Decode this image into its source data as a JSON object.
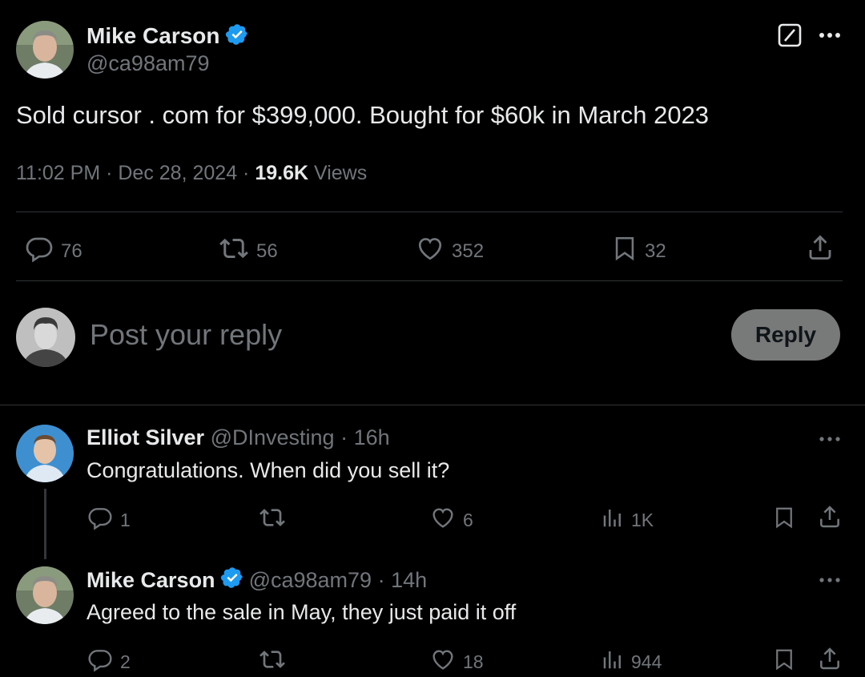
{
  "tweet": {
    "author_name": "Mike Carson",
    "author_handle": "@ca98am79",
    "text": "Sold cursor . com for $399,000. Bought for $60k in March 2023",
    "time": "11:02 PM",
    "date": "Dec 28, 2024",
    "views_count": "19.6K",
    "views_label": "Views",
    "stats": {
      "replies": "76",
      "reposts": "56",
      "likes": "352",
      "bookmarks": "32"
    }
  },
  "composer": {
    "placeholder": "Post your reply",
    "reply_label": "Reply"
  },
  "replies": [
    {
      "author_name": "Elliot Silver",
      "author_handle": "@DInvesting",
      "time": "16h",
      "text": "Congratulations. When did you sell it?",
      "replies": "1",
      "reposts": "",
      "likes": "6",
      "views": "1K"
    },
    {
      "author_name": "Mike Carson",
      "author_handle": "@ca98am79",
      "time": "14h",
      "text": "Agreed to the sale in May, they just paid it off",
      "replies": "2",
      "reposts": "",
      "likes": "18",
      "views": "944"
    }
  ],
  "colors": {
    "background": "#000000",
    "text": "#e7e9ea",
    "muted": "#71767b",
    "verified": "#1d9bf0",
    "divider": "#2f3336"
  }
}
